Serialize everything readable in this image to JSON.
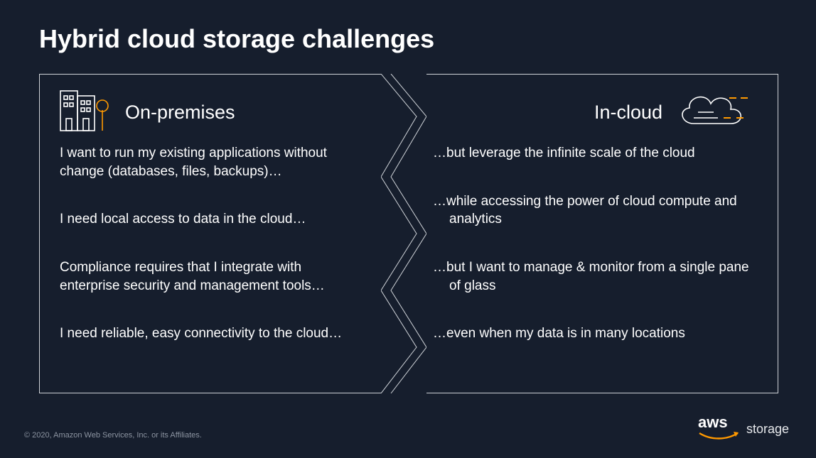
{
  "title": "Hybrid cloud storage challenges",
  "left": {
    "heading": "On-premises",
    "items": [
      "I want to run my existing applications without change (databases, files, backups)…",
      "I need local access to data in the cloud…",
      "Compliance requires that I integrate with enterprise security and management tools…",
      "I need reliable, easy connectivity to the cloud…"
    ]
  },
  "right": {
    "heading": "In-cloud",
    "items": [
      "…but leverage the infinite scale of the cloud",
      "…while accessing the power of cloud compute and analytics",
      "…but I want to manage & monitor from a single pane of glass",
      "…even when my data is in many locations"
    ]
  },
  "footer": {
    "copyright": "© 2020, Amazon Web Services, Inc. or its Affiliates.",
    "brand": "aws",
    "brand_sub": "storage"
  }
}
